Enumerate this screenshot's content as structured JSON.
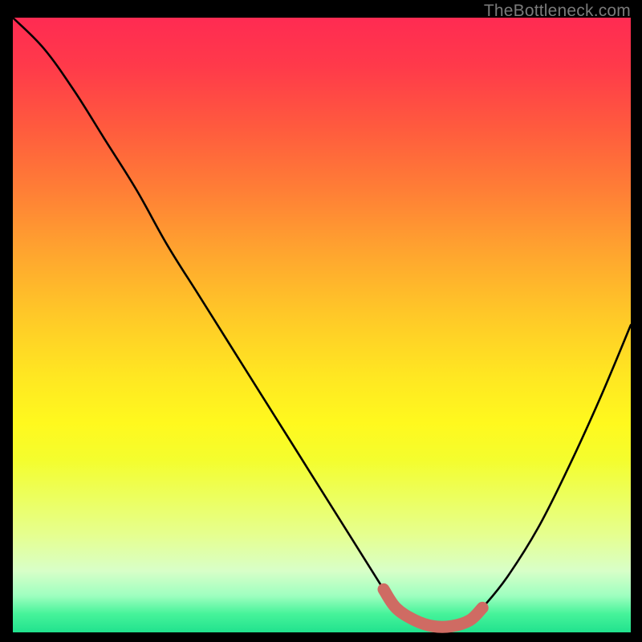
{
  "watermark": "TheBottleneck.com",
  "chart_data": {
    "type": "line",
    "title": "",
    "xlabel": "",
    "ylabel": "",
    "xlim": [
      0,
      100
    ],
    "ylim": [
      0,
      100
    ],
    "series": [
      {
        "name": "bottleneck-curve",
        "x": [
          0,
          5,
          10,
          15,
          20,
          25,
          30,
          35,
          40,
          45,
          50,
          55,
          60,
          62,
          65,
          68,
          71,
          74,
          76,
          80,
          85,
          90,
          95,
          100
        ],
        "values": [
          100,
          95,
          88,
          80,
          72,
          63,
          55,
          47,
          39,
          31,
          23,
          15,
          7,
          4,
          2,
          1,
          1,
          2,
          4,
          9,
          17,
          27,
          38,
          50
        ]
      },
      {
        "name": "optimal-zone-highlight",
        "x": [
          60,
          62,
          65,
          68,
          71,
          74,
          76
        ],
        "values": [
          7,
          4,
          2,
          1,
          1,
          2,
          4
        ]
      }
    ],
    "gradient_stops": [
      {
        "pos": 0,
        "color": "#ff2b52"
      },
      {
        "pos": 18,
        "color": "#ff5b3e"
      },
      {
        "pos": 48,
        "color": "#ffc728"
      },
      {
        "pos": 66,
        "color": "#fff91e"
      },
      {
        "pos": 90,
        "color": "#d8ffc8"
      },
      {
        "pos": 100,
        "color": "#21e28e"
      }
    ]
  }
}
